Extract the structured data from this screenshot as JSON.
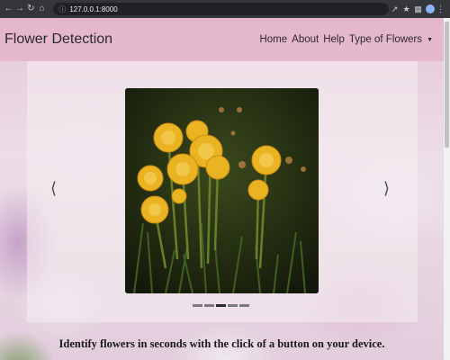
{
  "browser": {
    "url": "127.0.0.1:8000",
    "icons": [
      "back-icon",
      "forward-icon",
      "reload-icon",
      "home-icon",
      "lock-icon",
      "share-icon",
      "star-icon",
      "extensions-icon",
      "profile-icon"
    ]
  },
  "navbar": {
    "brand": "Flower Detection",
    "links": [
      "Home",
      "About",
      "Help",
      "Type of Flowers"
    ]
  },
  "carousel": {
    "image_subject": "yellow dandelions",
    "slide_count": 5,
    "active_slide": 3
  },
  "tagline": "Identify flowers in seconds with the click of a button on your device."
}
